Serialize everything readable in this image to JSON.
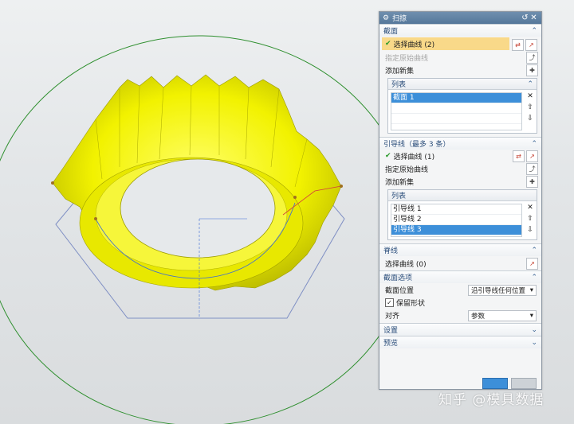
{
  "panel": {
    "title": "扫掠",
    "sections": {
      "section": {
        "title": "截面",
        "select_curve": "选择曲线 (2)",
        "specify_origin": "指定原始曲线",
        "add_new_set": "添加新集",
        "list_title": "列表",
        "list_items": [
          "截面 1"
        ]
      },
      "guide": {
        "title": "引导线（最多 3 条）",
        "select_curve": "选择曲线 (1)",
        "specify_origin": "指定原始曲线",
        "add_new_set": "添加新集",
        "list_title": "列表",
        "list_items": [
          "引导线 1",
          "引导线 2",
          "引导线 3"
        ]
      },
      "spine": {
        "title": "脊线",
        "select_curve": "选择曲线 (0)"
      },
      "section_options": {
        "title": "截面选项",
        "position_label": "截面位置",
        "position_value": "沿引导线任何位置",
        "preserve_shape": "保留形状",
        "align_label": "对齐",
        "align_value": "参数"
      },
      "settings": {
        "title": "设置"
      },
      "preview": {
        "title": "预览"
      }
    }
  },
  "watermark": "知乎 @模具数据",
  "colors": {
    "shape": "#f2f200",
    "shape_dark": "#9a9a00",
    "selection": "#f9d989",
    "list_active": "#3d8fd9"
  }
}
